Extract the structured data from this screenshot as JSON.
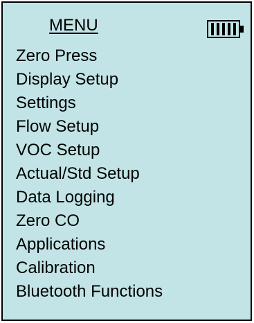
{
  "menu": {
    "title": "MENU",
    "battery_icon": "battery-full-icon",
    "items": [
      {
        "label": "Zero Press"
      },
      {
        "label": "Display Setup"
      },
      {
        "label": "Settings"
      },
      {
        "label": "Flow Setup"
      },
      {
        "label": "VOC Setup"
      },
      {
        "label": "Actual/Std Setup"
      },
      {
        "label": "Data Logging"
      },
      {
        "label": "Zero CO"
      },
      {
        "label": "Applications"
      },
      {
        "label": "Calibration"
      },
      {
        "label": "Bluetooth Functions"
      }
    ]
  },
  "colors": {
    "background": "#c2e4e6",
    "border": "#000000",
    "text": "#000000"
  }
}
